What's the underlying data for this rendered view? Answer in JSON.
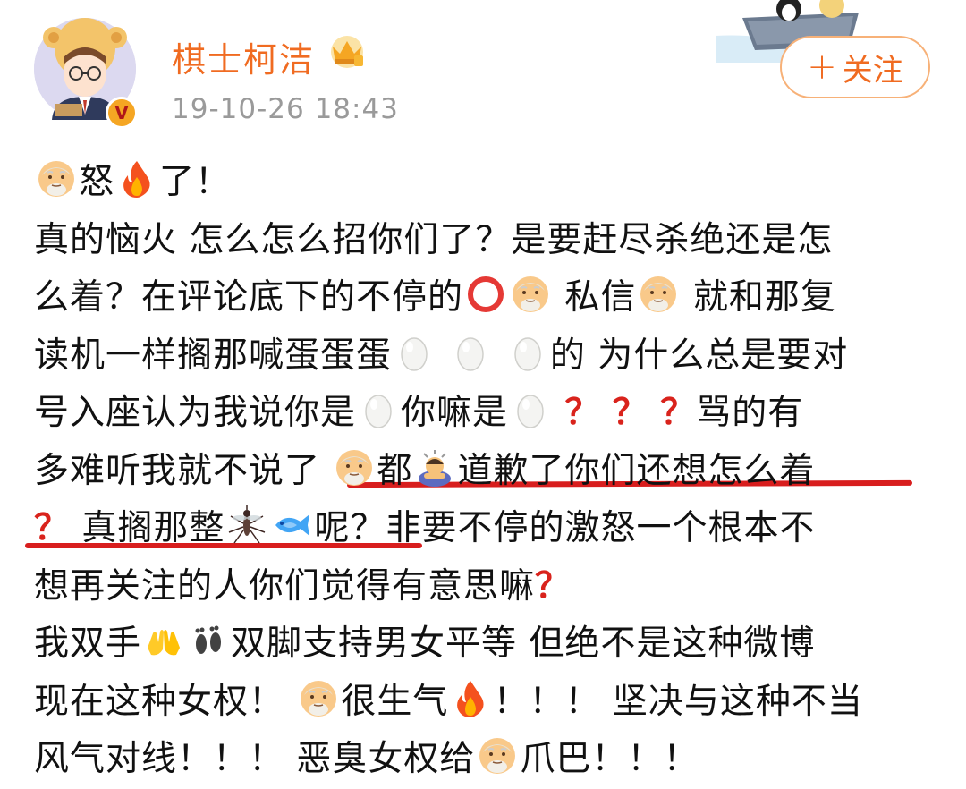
{
  "post": {
    "username": "棋士柯洁",
    "timestamp": "19-10-26 18:43",
    "follow_label": "关注",
    "follow_plus": "+",
    "verified_badge": "V"
  },
  "icons": {
    "avatar": "avatar-icon",
    "crown": "crown-icon",
    "verified": "verified-badge-icon",
    "face": "old-man-face-icon",
    "fire": "fire-icon",
    "circle": "red-circle-icon",
    "egg": "egg-icon",
    "question": "red-question-icon",
    "bow": "bowing-person-icon",
    "mosquito": "mosquito-icon",
    "fish": "fish-icon",
    "hands": "raised-hands-icon",
    "feet": "footprints-icon"
  },
  "colors": {
    "username": "#f06b21",
    "timestamp": "#9a9a9a",
    "underline": "#d81e1e",
    "question": "#d9231c"
  },
  "content": {
    "l1a": "怒",
    "l1b": "了！",
    "l2": "真的恼火 怎么怎么招你们了？是要赶尽杀绝还是怎",
    "l3a": "么着？在评论底下的不停的",
    "l3b": "私信",
    "l3c": "就和那复",
    "l4a": "读机一样搁那喊蛋蛋蛋",
    "l4b": "的 为什么总是要对",
    "l5a": "号入座认为我说你是",
    "l5b": "你嘛是",
    "l5q": "？",
    "l5c": "骂的有",
    "l6a": "多难听我就不说了",
    "l6b": "都",
    "l6c": "道歉了你们还想怎么着",
    "l7q": "？",
    "l7a": "真搁那整",
    "l7b": "呢？非要不停的激怒一个根本不",
    "l8a": "想再关注的人你们觉得有意思嘛",
    "l8q": "？",
    "l9a": "我双手",
    "l9b": "双脚支持男女平等 但绝不是这种微博",
    "l10a": "现在这种女权！",
    "l10b": "很生气",
    "l10c": "！！！ 坚决与这种不当",
    "l11a": "风气对线！！！ 恶臭女权给",
    "l11b": "爪巴！！！"
  }
}
